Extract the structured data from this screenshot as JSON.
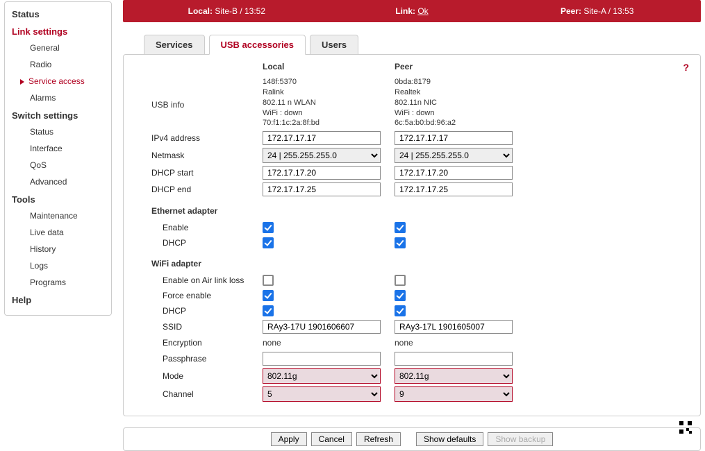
{
  "topbar": {
    "local_label": "Local:",
    "local_value": "Site-B / 13:52",
    "link_label": "Link:",
    "link_value": "Ok",
    "peer_label": "Peer:",
    "peer_value": "Site-A / 13:53"
  },
  "sidebar": {
    "status": "Status",
    "link_settings": "Link settings",
    "link_items": {
      "general": "General",
      "radio": "Radio",
      "service_access": "Service access",
      "alarms": "Alarms"
    },
    "switch_settings": "Switch settings",
    "switch_items": {
      "status": "Status",
      "interface": "Interface",
      "qos": "QoS",
      "advanced": "Advanced"
    },
    "tools": "Tools",
    "tools_items": {
      "maintenance": "Maintenance",
      "live_data": "Live data",
      "history": "History",
      "logs": "Logs",
      "programs": "Programs"
    },
    "help": "Help"
  },
  "tabs": {
    "services": "Services",
    "usb": "USB accessories",
    "users": "Users"
  },
  "headers": {
    "local": "Local",
    "peer": "Peer"
  },
  "labels": {
    "usb_info": "USB info",
    "ipv4": "IPv4 address",
    "netmask": "Netmask",
    "dhcp_start": "DHCP start",
    "dhcp_end": "DHCP end",
    "eth_adapter": "Ethernet adapter",
    "enable": "Enable",
    "dhcp": "DHCP",
    "wifi_adapter": "WiFi adapter",
    "enable_airloss": "Enable on Air link loss",
    "force_enable": "Force enable",
    "ssid": "SSID",
    "encryption": "Encryption",
    "passphrase": "Passphrase",
    "mode": "Mode",
    "channel": "Channel"
  },
  "usb_info": {
    "local": [
      "148f:5370",
      "Ralink",
      "802.11 n WLAN",
      "WiFi : down",
      "70:f1:1c:2a:8f:bd"
    ],
    "peer": [
      "0bda:8179",
      "Realtek",
      "802.11n NIC",
      "WiFi : down",
      "6c:5a:b0:bd:96:a2"
    ]
  },
  "values": {
    "local": {
      "ipv4": "172.17.17.17",
      "netmask": "24  |  255.255.255.0",
      "dhcp_start": "172.17.17.20",
      "dhcp_end": "172.17.17.25",
      "eth_enable": true,
      "eth_dhcp": true,
      "wifi_airloss": false,
      "wifi_force": true,
      "wifi_dhcp": true,
      "ssid": "RAy3-17U 1901606607",
      "encryption": "none",
      "passphrase": "",
      "mode": "802.11g",
      "channel": "5"
    },
    "peer": {
      "ipv4": "172.17.17.17",
      "netmask": "24  |  255.255.255.0",
      "dhcp_start": "172.17.17.20",
      "dhcp_end": "172.17.17.25",
      "eth_enable": true,
      "eth_dhcp": true,
      "wifi_airloss": false,
      "wifi_force": true,
      "wifi_dhcp": true,
      "ssid": "RAy3-17L 1901605007",
      "encryption": "none",
      "passphrase": "",
      "mode": "802.11g",
      "channel": "9"
    }
  },
  "buttons": {
    "apply": "Apply",
    "cancel": "Cancel",
    "refresh": "Refresh",
    "show_defaults": "Show defaults",
    "show_backup": "Show backup"
  },
  "help_icon": "?"
}
